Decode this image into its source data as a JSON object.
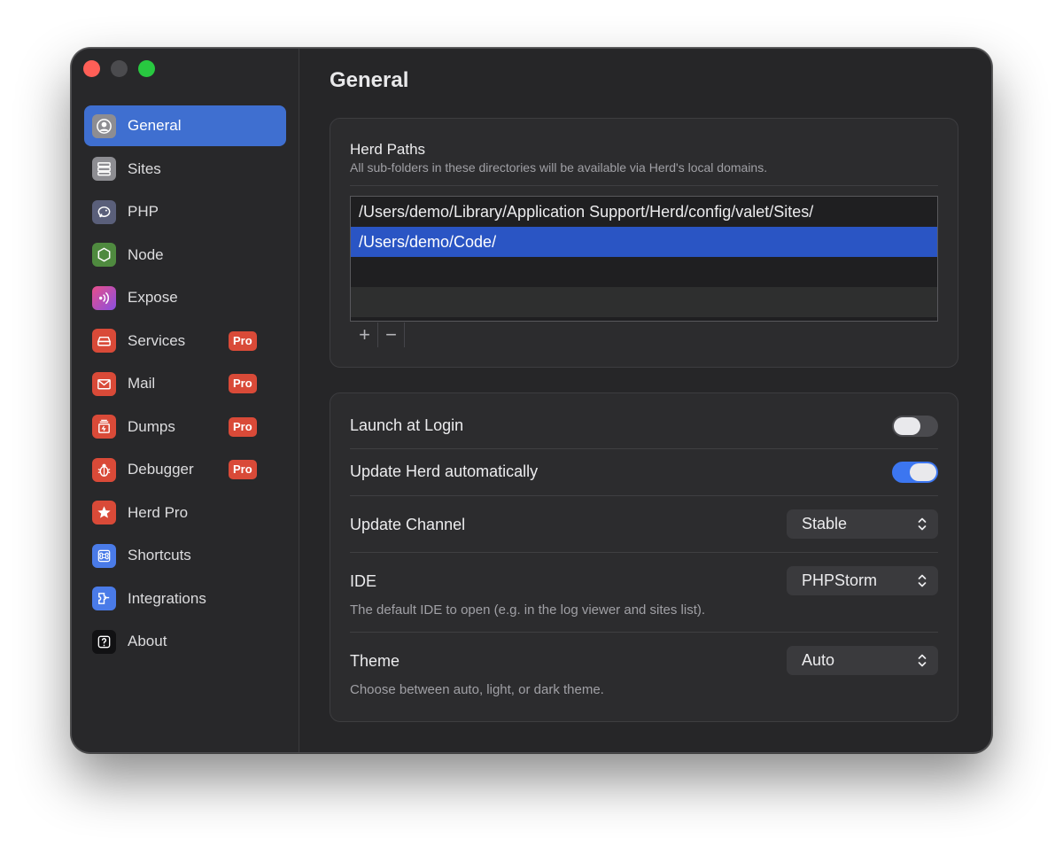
{
  "sidebar": {
    "items": [
      {
        "label": "General",
        "icon": "person-circle-icon",
        "active": true,
        "pro": false
      },
      {
        "label": "Sites",
        "icon": "server-rack-icon",
        "active": false,
        "pro": false
      },
      {
        "label": "PHP",
        "icon": "elephant-icon",
        "active": false,
        "pro": false
      },
      {
        "label": "Node",
        "icon": "hexagon-icon",
        "active": false,
        "pro": false
      },
      {
        "label": "Expose",
        "icon": "broadcast-icon",
        "active": false,
        "pro": false
      },
      {
        "label": "Services",
        "icon": "database-drive-icon",
        "active": false,
        "pro": true
      },
      {
        "label": "Mail",
        "icon": "envelope-icon",
        "active": false,
        "pro": true
      },
      {
        "label": "Dumps",
        "icon": "dump-stack-icon",
        "active": false,
        "pro": true
      },
      {
        "label": "Debugger",
        "icon": "bug-icon",
        "active": false,
        "pro": true
      },
      {
        "label": "Herd Pro",
        "icon": "star-icon",
        "active": false,
        "pro": false
      },
      {
        "label": "Shortcuts",
        "icon": "command-key-icon",
        "active": false,
        "pro": false
      },
      {
        "label": "Integrations",
        "icon": "plug-icon",
        "active": false,
        "pro": false
      },
      {
        "label": "About",
        "icon": "question-mark-icon",
        "active": false,
        "pro": false
      }
    ],
    "pro_label": "Pro"
  },
  "page": {
    "title": "General"
  },
  "herd_paths": {
    "title": "Herd Paths",
    "description": "All sub-folders in these directories will be available via Herd's local domains.",
    "paths": [
      "/Users/demo/Library/Application Support/Herd/config/valet/Sites/",
      "/Users/demo/Code/"
    ],
    "selected_index": 1,
    "add_label": "+",
    "remove_label": "−"
  },
  "settings": {
    "launch_at_login": {
      "label": "Launch at Login",
      "enabled": false
    },
    "auto_update": {
      "label": "Update Herd automatically",
      "enabled": true
    },
    "update_channel": {
      "label": "Update Channel",
      "value": "Stable"
    },
    "ide": {
      "label": "IDE",
      "value": "PHPStorm",
      "description": "The default IDE to open (e.g. in the log viewer and sites list)."
    },
    "theme": {
      "label": "Theme",
      "value": "Auto",
      "description": "Choose between auto, light, or dark theme."
    }
  },
  "colors": {
    "accent": "#3f6fd0",
    "selection": "#2a55c4",
    "toggle_on": "#3c76f0",
    "pro_badge": "#d94a38"
  }
}
